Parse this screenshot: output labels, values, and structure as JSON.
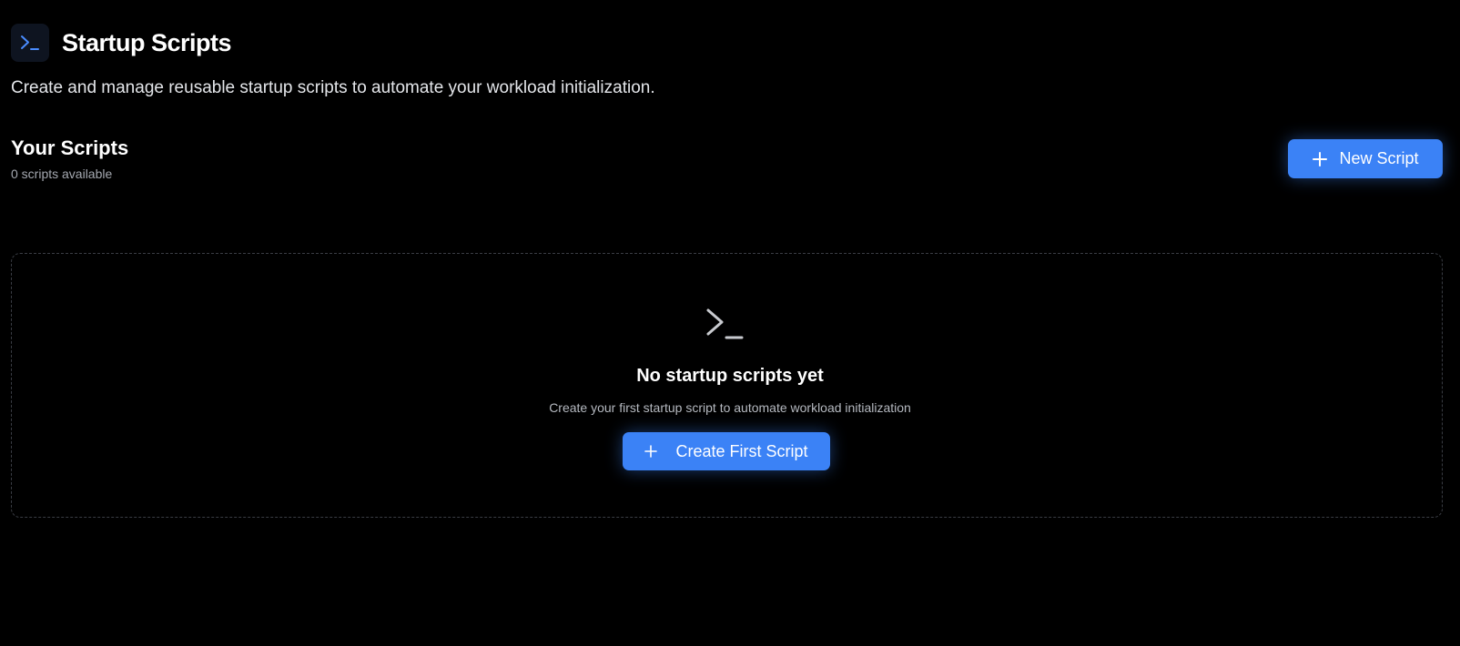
{
  "header": {
    "title": "Startup Scripts",
    "icon": "terminal-icon",
    "description": "Create and manage reusable startup scripts to automate your workload initialization."
  },
  "section": {
    "title": "Your Scripts",
    "count_text": "0 scripts available",
    "new_button_label": "New Script",
    "new_button_icon": "plus-icon"
  },
  "empty_state": {
    "icon": "terminal-icon",
    "title": "No startup scripts yet",
    "subtitle": "Create your first startup script to automate workload initialization",
    "button_label": "Create First Script",
    "button_icon": "plus-icon"
  },
  "colors": {
    "background": "#000000",
    "accent": "#3b82f6",
    "icon_accent": "#4a8cff",
    "muted_text": "#a4a8b0",
    "dashed_border": "#3a3d44"
  }
}
